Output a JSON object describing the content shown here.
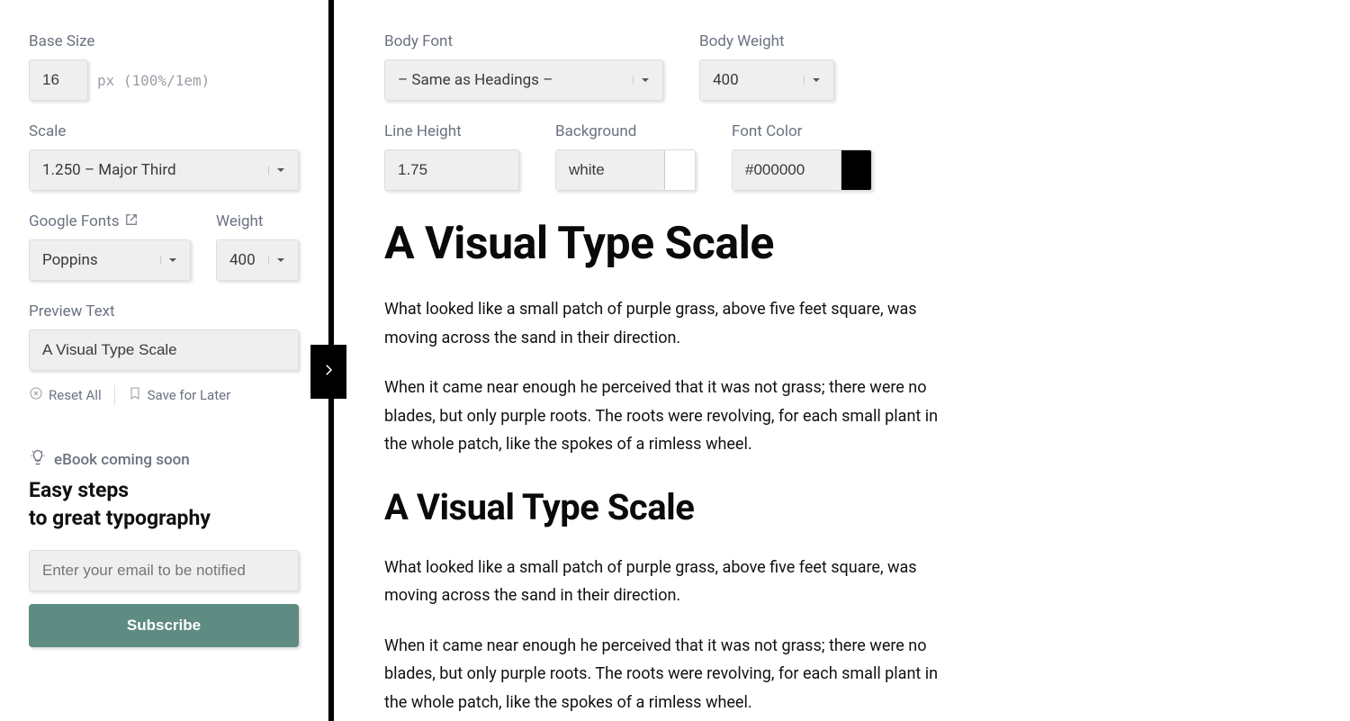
{
  "sidebar": {
    "baseSize": {
      "label": "Base Size",
      "value": "16",
      "unit": "px (100%/1em)"
    },
    "scale": {
      "label": "Scale",
      "value": "1.250 – Major Third"
    },
    "googleFonts": {
      "label": "Google Fonts",
      "value": "Poppins"
    },
    "weight": {
      "label": "Weight",
      "value": "400"
    },
    "previewText": {
      "label": "Preview Text",
      "value": "A Visual Type Scale"
    },
    "resetAll": "Reset All",
    "saveLater": "Save for Later",
    "promo": {
      "eyebrow": "eBook coming soon",
      "headline1": "Easy steps",
      "headline2": "to great typography",
      "emailPlaceholder": "Enter your email to be notified",
      "subscribe": "Subscribe"
    }
  },
  "main": {
    "bodyFont": {
      "label": "Body Font",
      "value": "– Same as Headings –"
    },
    "bodyWeight": {
      "label": "Body Weight",
      "value": "400"
    },
    "lineHeight": {
      "label": "Line Height",
      "value": "1.75"
    },
    "background": {
      "label": "Background",
      "value": "white",
      "swatch": "#ffffff"
    },
    "fontColor": {
      "label": "Font Color",
      "value": "#000000",
      "swatch": "#000000"
    },
    "preview": {
      "heading": "A Visual Type Scale",
      "p1": "What looked like a small patch of purple grass, above five feet square, was moving across the sand in their direction.",
      "p2": "When it came near enough he perceived that it was not grass; there were no blades, but only purple roots. The roots were revolving, for each small plant in the whole patch, like the spokes of a rimless wheel."
    }
  }
}
